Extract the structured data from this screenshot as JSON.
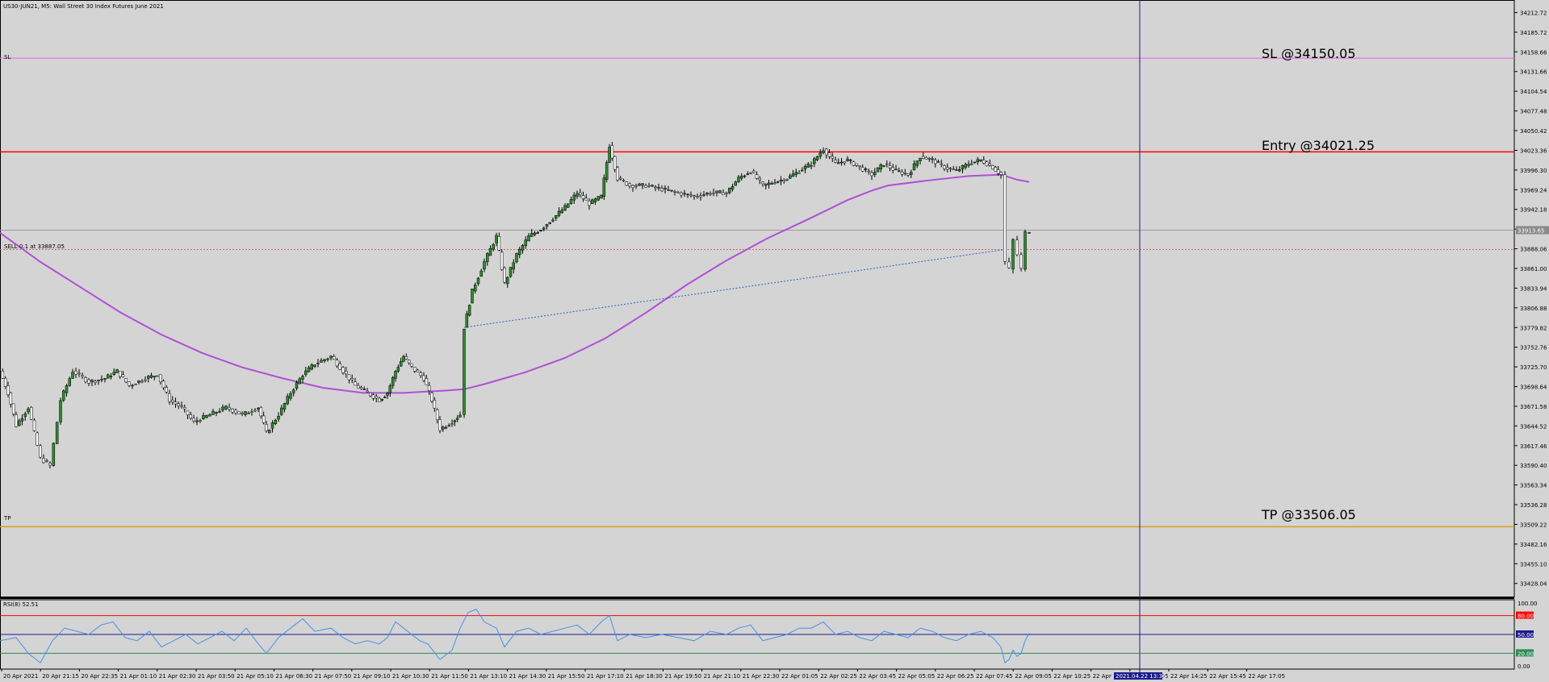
{
  "header": {
    "title": "US30-JUN21, M5:  Wall Street 30 Index Futures June 2021"
  },
  "colors": {
    "background": "#d4d4d4",
    "sl_line": "#e07ae0",
    "entry_line": "#ff0000",
    "tp_line": "#d4a017",
    "ma_line": "#b14fd6",
    "rsi_line": "#4a90e2",
    "rsi_upper": "#ff0000",
    "rsi_mid": "#1a1a8c",
    "rsi_lower": "#2e8b57",
    "crosshair": "#1a1a8c",
    "bull_candle": "#2e8b2e",
    "bear_candle": "#000000"
  },
  "annotations": {
    "sl_tag": "SL",
    "tp_tag": "TP",
    "sell_tag": "SELL 0.1 at 33887.05",
    "sl_label": "SL @34150.05",
    "entry_label": "Entry @34021.25",
    "tp_label": "TP @33506.05",
    "current_price": "33913.65",
    "crosshair_time": "2021.04.22 13:30"
  },
  "rsi": {
    "title": "RSI(8) 52.51",
    "ticks": [
      "100.00",
      "80.00",
      "50.00",
      "20.00",
      "0.00"
    ],
    "levels": [
      80,
      50,
      20
    ],
    "value": 52.51
  },
  "chart_data": {
    "type": "line",
    "title": "US30-JUN21, M5:  Wall Street 30 Index Futures June 2021",
    "ylim": [
      33410,
      34230
    ],
    "y_ticks": [
      "34212.72",
      "34185.72",
      "34158.66",
      "34131.66",
      "34104.54",
      "34077.48",
      "34050.42",
      "34023.36",
      "33996.30",
      "33969.24",
      "33942.18",
      "33915.12",
      "33888.06",
      "33861.00",
      "33833.94",
      "33806.88",
      "33779.82",
      "33752.76",
      "33725.70",
      "33698.64",
      "33671.58",
      "33644.52",
      "33617.46",
      "33590.40",
      "33563.34",
      "33536.28",
      "33509.22",
      "33482.16",
      "33455.10",
      "33428.04"
    ],
    "x_ticks": [
      "20 Apr 2021",
      "20 Apr 21:15",
      "20 Apr 22:35",
      "21 Apr 01:10",
      "21 Apr 02:30",
      "21 Apr 03:50",
      "21 Apr 05:10",
      "21 Apr 06:30",
      "21 Apr 07:50",
      "21 Apr 09:10",
      "21 Apr 10:30",
      "21 Apr 11:50",
      "21 Apr 13:10",
      "21 Apr 14:30",
      "21 Apr 15:50",
      "21 Apr 17:10",
      "21 Apr 18:30",
      "21 Apr 19:50",
      "21 Apr 21:10",
      "21 Apr 22:30",
      "22 Apr 01:05",
      "22 Apr 02:25",
      "22 Apr 03:45",
      "22 Apr 05:05",
      "22 Apr 06:25",
      "22 Apr 07:45",
      "22 Apr 09:05",
      "22 Apr 10:25",
      "22 Apr 11:45",
      "22 Apr 13:05",
      "22 Apr 14:25",
      "22 Apr 15:45",
      "22 Apr 17:05"
    ],
    "levels": {
      "sl": 34150.05,
      "entry": 34021.25,
      "sell": 33887.05,
      "tp": 33506.05,
      "current": 33913.65
    },
    "series": [
      {
        "name": "price",
        "points": [
          [
            0,
            33720
          ],
          [
            10,
            33690
          ],
          [
            20,
            33645
          ],
          [
            35,
            33670
          ],
          [
            50,
            33600
          ],
          [
            62,
            33590
          ],
          [
            75,
            33680
          ],
          [
            90,
            33720
          ],
          [
            110,
            33705
          ],
          [
            130,
            33710
          ],
          [
            145,
            33720
          ],
          [
            160,
            33700
          ],
          [
            180,
            33710
          ],
          [
            195,
            33715
          ],
          [
            210,
            33680
          ],
          [
            225,
            33670
          ],
          [
            240,
            33650
          ],
          [
            260,
            33660
          ],
          [
            280,
            33670
          ],
          [
            300,
            33660
          ],
          [
            320,
            33670
          ],
          [
            330,
            33635
          ],
          [
            345,
            33660
          ],
          [
            360,
            33690
          ],
          [
            375,
            33715
          ],
          [
            390,
            33730
          ],
          [
            410,
            33740
          ],
          [
            425,
            33720
          ],
          [
            440,
            33700
          ],
          [
            455,
            33690
          ],
          [
            470,
            33680
          ],
          [
            480,
            33690
          ],
          [
            490,
            33720
          ],
          [
            500,
            33740
          ],
          [
            510,
            33725
          ],
          [
            525,
            33710
          ],
          [
            535,
            33680
          ],
          [
            545,
            33640
          ],
          [
            560,
            33650
          ],
          [
            570,
            33660
          ],
          [
            575,
            33780
          ],
          [
            585,
            33830
          ],
          [
            600,
            33870
          ],
          [
            615,
            33905
          ],
          [
            625,
            33840
          ],
          [
            640,
            33880
          ],
          [
            655,
            33905
          ],
          [
            670,
            33915
          ],
          [
            685,
            33930
          ],
          [
            700,
            33945
          ],
          [
            715,
            33965
          ],
          [
            730,
            33950
          ],
          [
            745,
            33960
          ],
          [
            755,
            34030
          ],
          [
            765,
            33985
          ],
          [
            780,
            33975
          ],
          [
            800,
            33975
          ],
          [
            820,
            33970
          ],
          [
            840,
            33965
          ],
          [
            860,
            33960
          ],
          [
            880,
            33965
          ],
          [
            900,
            33965
          ],
          [
            915,
            33985
          ],
          [
            930,
            33995
          ],
          [
            945,
            33975
          ],
          [
            960,
            33980
          ],
          [
            975,
            33985
          ],
          [
            990,
            33995
          ],
          [
            1005,
            34005
          ],
          [
            1020,
            34025
          ],
          [
            1035,
            34005
          ],
          [
            1050,
            34010
          ],
          [
            1065,
            34000
          ],
          [
            1080,
            33990
          ],
          [
            1095,
            34005
          ],
          [
            1110,
            33995
          ],
          [
            1125,
            33990
          ],
          [
            1140,
            34015
          ],
          [
            1155,
            34010
          ],
          [
            1170,
            34000
          ],
          [
            1185,
            33995
          ],
          [
            1200,
            34005
          ],
          [
            1215,
            34010
          ],
          [
            1230,
            34000
          ],
          [
            1240,
            33990
          ],
          [
            1245,
            33870
          ],
          [
            1250,
            33860
          ],
          [
            1255,
            33900
          ],
          [
            1260,
            33880
          ],
          [
            1265,
            33860
          ],
          [
            1270,
            33910
          ],
          [
            1275,
            33913
          ]
        ]
      },
      {
        "name": "ma",
        "points": [
          [
            0,
            33910
          ],
          [
            50,
            33870
          ],
          [
            100,
            33835
          ],
          [
            150,
            33800
          ],
          [
            200,
            33770
          ],
          [
            250,
            33745
          ],
          [
            300,
            33725
          ],
          [
            350,
            33710
          ],
          [
            400,
            33697
          ],
          [
            450,
            33690
          ],
          [
            500,
            33690
          ],
          [
            550,
            33693
          ],
          [
            575,
            33695
          ],
          [
            600,
            33702
          ],
          [
            650,
            33718
          ],
          [
            700,
            33738
          ],
          [
            750,
            33765
          ],
          [
            800,
            33800
          ],
          [
            850,
            33838
          ],
          [
            900,
            33872
          ],
          [
            950,
            33902
          ],
          [
            1000,
            33928
          ],
          [
            1050,
            33955
          ],
          [
            1080,
            33968
          ],
          [
            1100,
            33975
          ],
          [
            1150,
            33982
          ],
          [
            1200,
            33988
          ],
          [
            1240,
            33990
          ],
          [
            1260,
            33983
          ],
          [
            1275,
            33980
          ]
        ]
      },
      {
        "name": "rsi",
        "points": [
          [
            0,
            40
          ],
          [
            20,
            45
          ],
          [
            35,
            20
          ],
          [
            50,
            5
          ],
          [
            65,
            40
          ],
          [
            80,
            60
          ],
          [
            95,
            55
          ],
          [
            110,
            50
          ],
          [
            125,
            65
          ],
          [
            140,
            70
          ],
          [
            155,
            45
          ],
          [
            170,
            40
          ],
          [
            185,
            55
          ],
          [
            200,
            30
          ],
          [
            215,
            40
          ],
          [
            230,
            50
          ],
          [
            245,
            35
          ],
          [
            260,
            45
          ],
          [
            275,
            55
          ],
          [
            290,
            40
          ],
          [
            305,
            60
          ],
          [
            320,
            35
          ],
          [
            330,
            20
          ],
          [
            345,
            45
          ],
          [
            360,
            60
          ],
          [
            375,
            75
          ],
          [
            390,
            55
          ],
          [
            410,
            60
          ],
          [
            425,
            45
          ],
          [
            440,
            35
          ],
          [
            455,
            40
          ],
          [
            470,
            35
          ],
          [
            480,
            45
          ],
          [
            490,
            70
          ],
          [
            500,
            60
          ],
          [
            510,
            50
          ],
          [
            520,
            40
          ],
          [
            530,
            35
          ],
          [
            545,
            10
          ],
          [
            560,
            25
          ],
          [
            570,
            60
          ],
          [
            580,
            85
          ],
          [
            590,
            90
          ],
          [
            600,
            70
          ],
          [
            615,
            60
          ],
          [
            625,
            30
          ],
          [
            640,
            55
          ],
          [
            655,
            60
          ],
          [
            670,
            50
          ],
          [
            685,
            55
          ],
          [
            700,
            60
          ],
          [
            715,
            65
          ],
          [
            730,
            50
          ],
          [
            745,
            70
          ],
          [
            755,
            80
          ],
          [
            765,
            40
          ],
          [
            780,
            50
          ],
          [
            800,
            45
          ],
          [
            820,
            50
          ],
          [
            840,
            45
          ],
          [
            860,
            40
          ],
          [
            880,
            55
          ],
          [
            900,
            50
          ],
          [
            915,
            60
          ],
          [
            930,
            65
          ],
          [
            945,
            40
          ],
          [
            960,
            45
          ],
          [
            975,
            50
          ],
          [
            990,
            60
          ],
          [
            1005,
            60
          ],
          [
            1020,
            70
          ],
          [
            1035,
            50
          ],
          [
            1050,
            55
          ],
          [
            1065,
            45
          ],
          [
            1080,
            40
          ],
          [
            1095,
            55
          ],
          [
            1110,
            50
          ],
          [
            1125,
            45
          ],
          [
            1140,
            60
          ],
          [
            1155,
            55
          ],
          [
            1170,
            45
          ],
          [
            1185,
            40
          ],
          [
            1200,
            50
          ],
          [
            1215,
            55
          ],
          [
            1230,
            45
          ],
          [
            1240,
            30
          ],
          [
            1245,
            5
          ],
          [
            1250,
            10
          ],
          [
            1255,
            25
          ],
          [
            1260,
            15
          ],
          [
            1265,
            20
          ],
          [
            1270,
            40
          ],
          [
            1275,
            52
          ]
        ]
      }
    ],
    "trade_lines": [
      {
        "name": "entry-link",
        "from": [
          575,
          33780
        ],
        "to": [
          1245,
          33887.05
        ]
      }
    ]
  }
}
